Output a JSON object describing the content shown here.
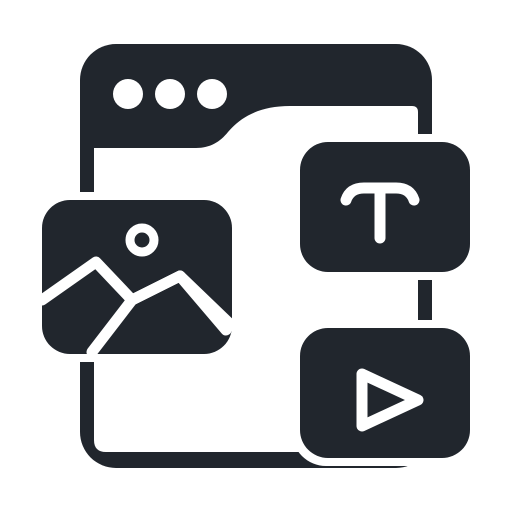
{
  "icon": {
    "name": "web-content-media-icon",
    "colors": {
      "ink": "#21262d",
      "paper": "#ffffff"
    },
    "window_dots": 3,
    "tiles": [
      "image-icon",
      "text-icon",
      "video-play-icon"
    ]
  }
}
